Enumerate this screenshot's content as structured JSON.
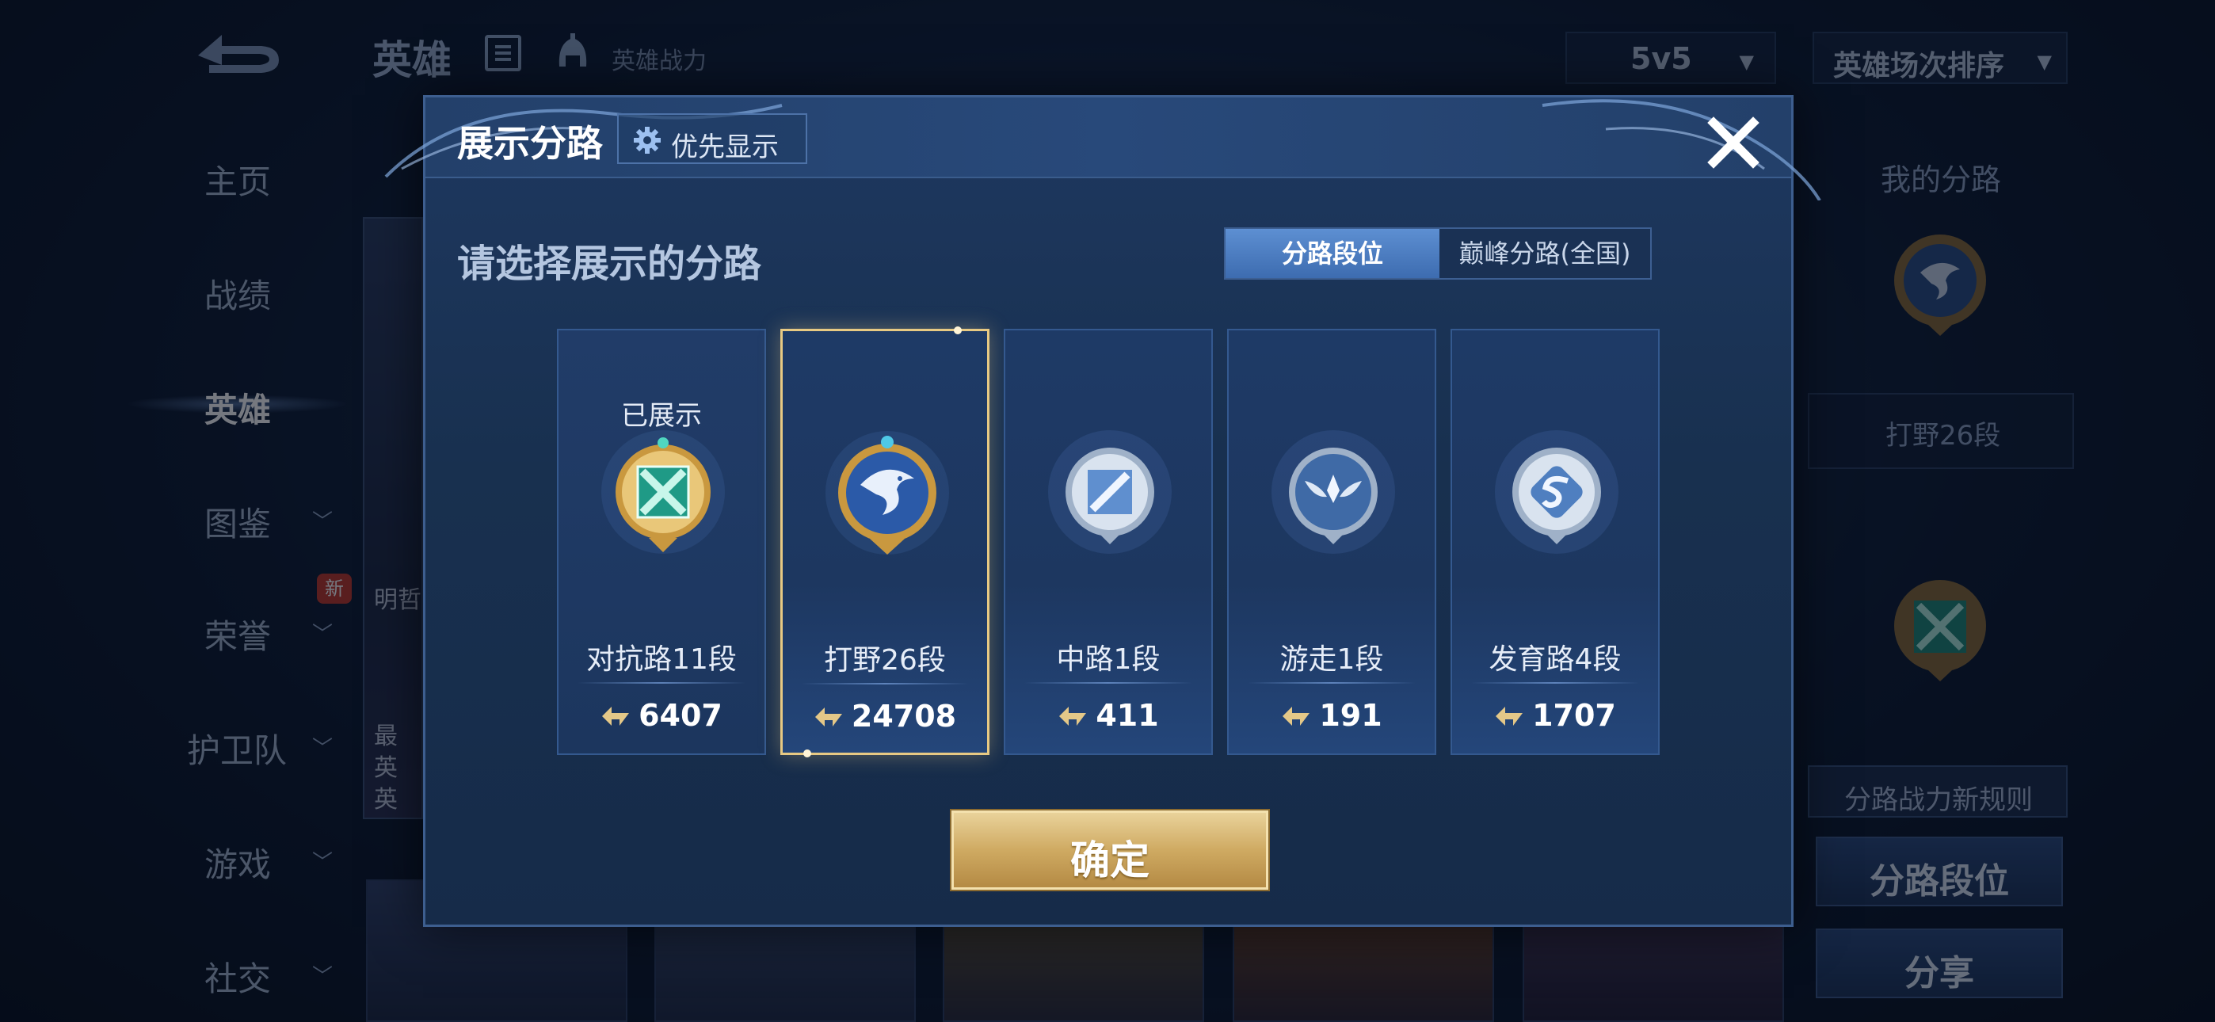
{
  "background": {
    "top_title": "英雄",
    "top_subtitle": "英雄战力",
    "mode_select": "5v5",
    "sort_select": "英雄场次排序",
    "side_nav": [
      {
        "label": "主页",
        "has_chevron": false
      },
      {
        "label": "战绩",
        "has_chevron": false
      },
      {
        "label": "英雄",
        "has_chevron": false,
        "active": true
      },
      {
        "label": "图鉴",
        "has_chevron": true
      },
      {
        "label": "荣誉",
        "has_chevron": true
      },
      {
        "label": "护卫队",
        "has_chevron": true
      },
      {
        "label": "游戏",
        "has_chevron": true
      },
      {
        "label": "社交",
        "has_chevron": true
      }
    ],
    "new_badge": "新",
    "hero_card_lines": [
      "明哲"
    ],
    "hero_card_lines2": [
      "最",
      "英",
      "英"
    ],
    "right_panel": {
      "title": "我的分路",
      "rank_label": "打野26段",
      "rule_button": "分路战力新规则",
      "lane_rank_button": "分路段位",
      "share_button": "分享"
    }
  },
  "modal": {
    "title": "展示分路",
    "priority_button": "优先显示",
    "subtitle": "请选择展示的分路",
    "tabs": [
      {
        "label": "分路段位",
        "active": true
      },
      {
        "label": "巅峰分路(全国)",
        "active": false
      }
    ],
    "lanes": [
      {
        "name": "对抗路11段",
        "score": "6407",
        "shown_label": "已展示",
        "emblem": "clash-lane-emblem-icon",
        "tier": "gold-green",
        "selected": false
      },
      {
        "name": "打野26段",
        "score": "24708",
        "shown_label": "",
        "emblem": "jungle-dragon-emblem-icon",
        "tier": "gold-blue",
        "selected": true
      },
      {
        "name": "中路1段",
        "score": "411",
        "shown_label": "",
        "emblem": "mid-lane-emblem-icon",
        "tier": "silver",
        "selected": false
      },
      {
        "name": "游走1段",
        "score": "191",
        "shown_label": "",
        "emblem": "roam-wings-emblem-icon",
        "tier": "silver",
        "selected": false
      },
      {
        "name": "发育路4段",
        "score": "1707",
        "shown_label": "",
        "emblem": "farm-lane-emblem-icon",
        "tier": "silver",
        "selected": false
      }
    ],
    "confirm_button": "确定"
  },
  "colors": {
    "accent_gold": "#e7c983",
    "tab_active": "#4f80c4",
    "modal_bg": "#18304f"
  }
}
